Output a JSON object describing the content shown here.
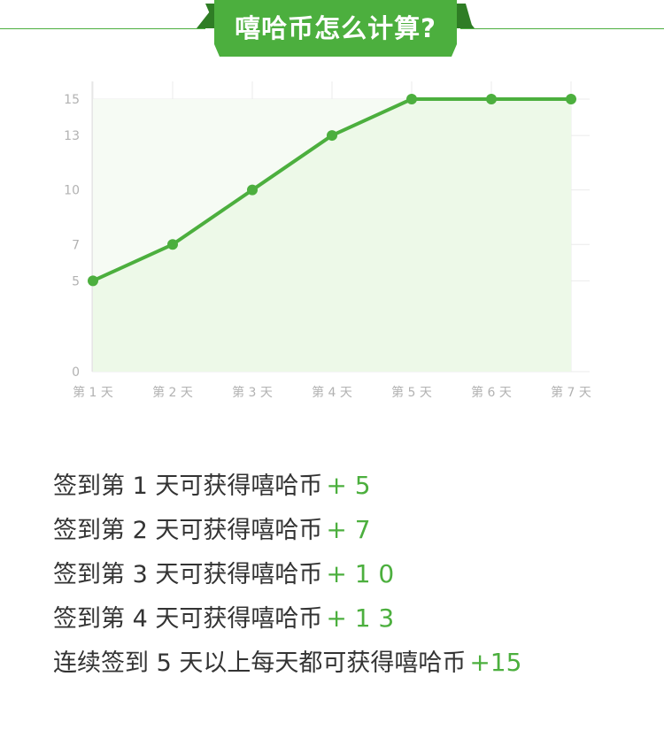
{
  "header": {
    "title": "嘻哈币怎么计算?",
    "colors": {
      "accent": "#4caf3e",
      "accent_dark": "#2f7d25"
    }
  },
  "chart_data": {
    "type": "area",
    "categories": [
      "第 1 天",
      "第 2 天",
      "第 3 天",
      "第 4 天",
      "第 5 天",
      "第 6 天",
      "第 7 天"
    ],
    "values": [
      5,
      7,
      10,
      13,
      15,
      15,
      15
    ],
    "y_ticks": [
      0,
      5,
      7,
      10,
      13,
      15
    ],
    "ylim": [
      0,
      15
    ],
    "grid": true,
    "colors": {
      "line": "#4caf3e",
      "fill": "#ecf9e7",
      "grid": "#ebebeb",
      "tick": "#b2b2b2"
    }
  },
  "rules": [
    {
      "text": "签到第 1 天可获得嘻哈币",
      "reward": "+ 5"
    },
    {
      "text": "签到第 2 天可获得嘻哈币",
      "reward": "+ 7"
    },
    {
      "text": "签到第 3 天可获得嘻哈币",
      "reward": "+ 1 0"
    },
    {
      "text": "签到第 4 天可获得嘻哈币",
      "reward": "+ 1 3"
    },
    {
      "text": "连续签到 5 天以上每天都可获得嘻哈币",
      "reward": "+15"
    }
  ]
}
